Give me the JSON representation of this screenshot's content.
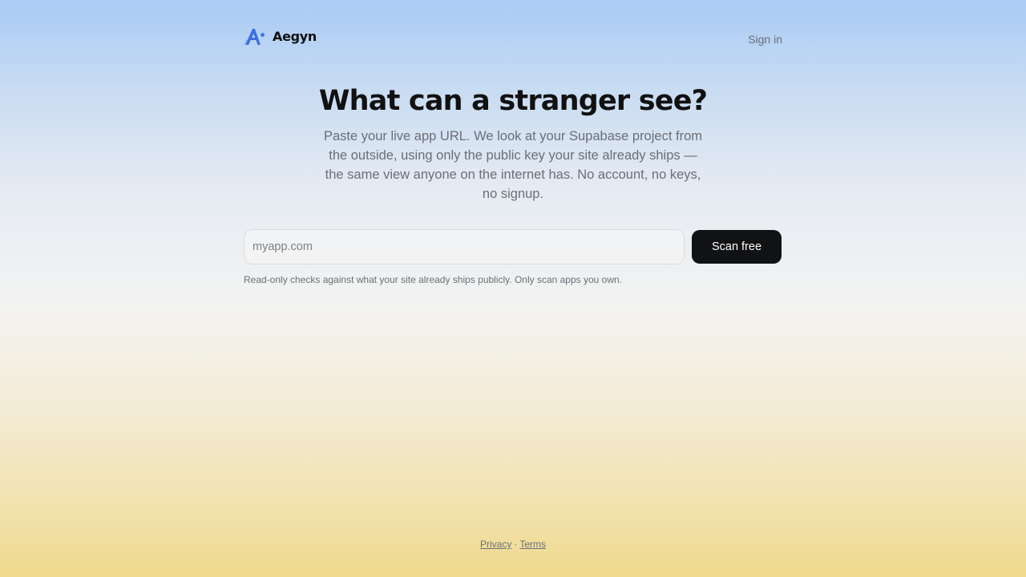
{
  "header": {
    "brand_name": "Aegyn",
    "signin_label": "Sign in"
  },
  "hero": {
    "title": "What can a stranger see?",
    "subtitle": "Paste your live app URL. We look at your Supabase project from the outside, using only the public key your site already ships — the same view anyone on the internet has. No account, no keys, no signup."
  },
  "scan_form": {
    "input_placeholder": "myapp.com",
    "input_value": "",
    "button_label": "Scan free",
    "disclaimer": "Read-only checks against what your site already ships publicly. Only scan apps you own."
  },
  "footer": {
    "privacy_label": "Privacy",
    "separator": "·",
    "terms_label": "Terms"
  },
  "colors": {
    "brand_blue": "#3b6fe0",
    "button_bg": "#111214",
    "muted_text": "#6b6f76"
  },
  "icons": {
    "logo": "aegyn-logo-icon"
  }
}
